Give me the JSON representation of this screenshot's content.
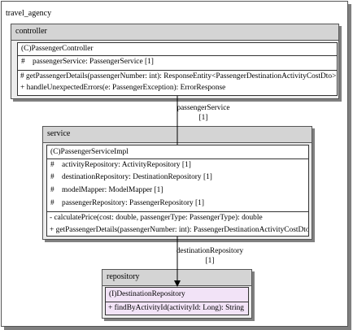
{
  "root_package": {
    "label": "travel_agency"
  },
  "controller": {
    "label": "controller",
    "class_name": "(C)PassengerController",
    "fields": [
      {
        "vis": "#",
        "text": "passengerService: PassengerService [1]"
      }
    ],
    "methods": [
      "# getPassengerDetails(passengerNumber: int): ResponseEntity<PassengerDestinationActivityCostDto>",
      "+ handleUnexpectedErrors(e: PassengerException): ErrorResponse"
    ]
  },
  "service": {
    "label": "service",
    "class_name": "(C)PassengerServiceImpl",
    "fields": [
      {
        "vis": "#",
        "text": "activityRepository: ActivityRepository [1]"
      },
      {
        "vis": "#",
        "text": "destinationRepository: DestinationRepository [1]"
      },
      {
        "vis": "#",
        "text": "modelMapper: ModelMapper [1]"
      },
      {
        "vis": "#",
        "text": "passengerRepository: PassengerRepository [1]"
      }
    ],
    "methods": [
      "- calculatePrice(cost: double, passengerType: PassengerType): double",
      "+ getPassengerDetails(passengerNumber: int): PassengerDestinationActivityCostDto"
    ]
  },
  "repository": {
    "label": "repository",
    "class_name": "(I)DestinationRepository",
    "methods": [
      "+ findByActivityId(activityId: Long): String"
    ]
  },
  "connectors": [
    {
      "name": "passengerService",
      "multiplicity": "[1]"
    },
    {
      "name": "destinationRepository",
      "multiplicity": "[1]"
    }
  ],
  "colors": {
    "package_fill": "#ededed",
    "package_header": "#d4d4d4",
    "class_fill": "#ffffff",
    "interface_fill": "#f2e3f7",
    "line": "#000000"
  }
}
